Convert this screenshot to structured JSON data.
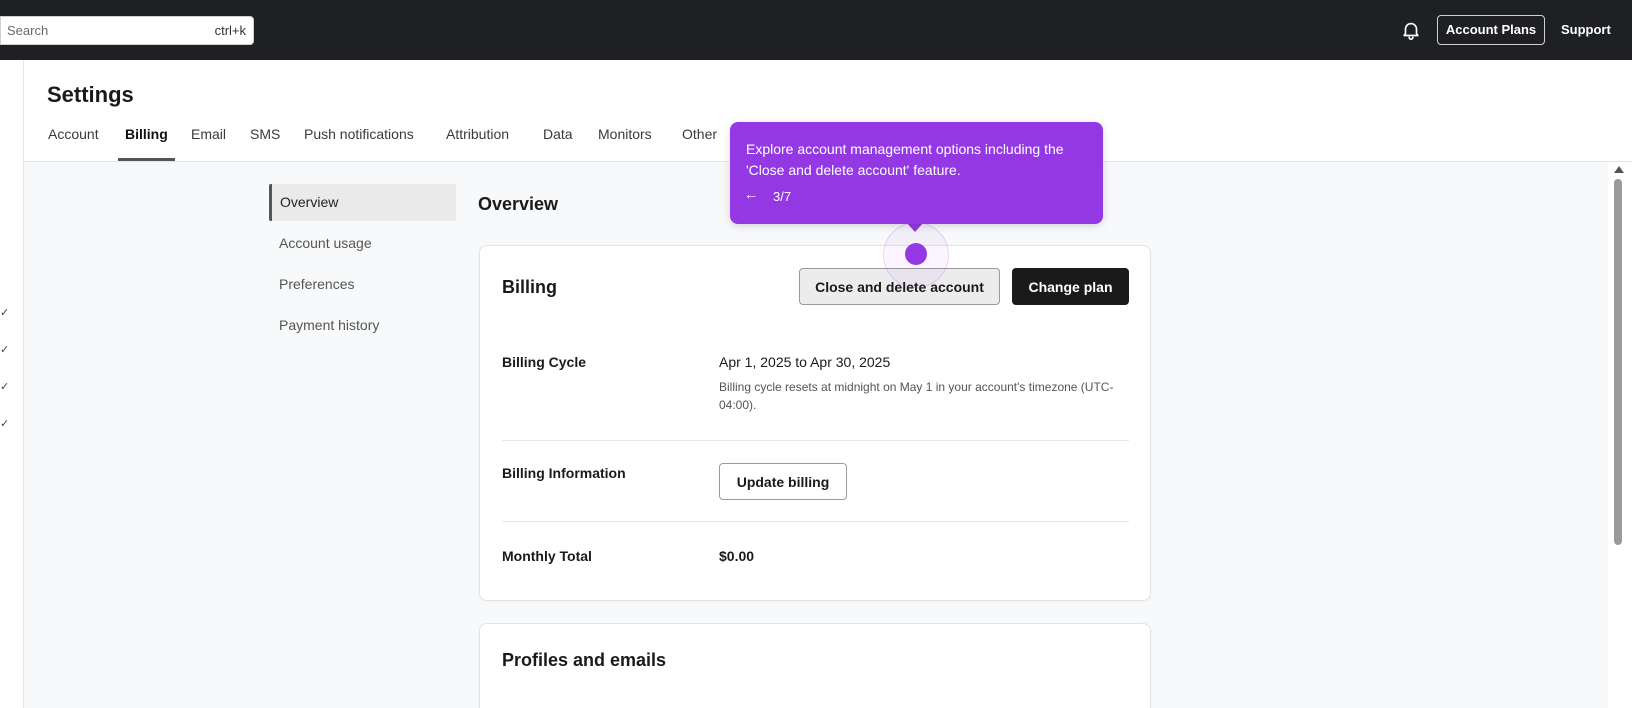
{
  "topbar": {
    "search_placeholder": "Search",
    "search_shortcut": "ctrl+k",
    "account_plans_label": "Account Plans",
    "support_label": "Support",
    "icons": {
      "notifications": "bell-icon"
    }
  },
  "page": {
    "title": "Settings",
    "tabs": [
      {
        "label": "Account"
      },
      {
        "label": "Billing",
        "active": true
      },
      {
        "label": "Email"
      },
      {
        "label": "SMS"
      },
      {
        "label": "Push notifications"
      },
      {
        "label": "Attribution"
      },
      {
        "label": "Data"
      },
      {
        "label": "Monitors"
      },
      {
        "label": "Other"
      }
    ]
  },
  "left_strip": {
    "checks": [
      "✓",
      "✓",
      "✓",
      "✓"
    ]
  },
  "sidenav": {
    "items": [
      {
        "label": "Overview",
        "active": true
      },
      {
        "label": "Account usage"
      },
      {
        "label": "Preferences"
      },
      {
        "label": "Payment history"
      }
    ]
  },
  "overview": {
    "title": "Overview",
    "billing_card": {
      "title": "Billing",
      "close_delete_label": "Close and delete account",
      "change_plan_label": "Change plan",
      "billing_cycle_label": "Billing Cycle",
      "billing_cycle_value": "Apr 1, 2025 to Apr 30, 2025",
      "billing_cycle_note": "Billing cycle resets at midnight on May 1 in your account's timezone (UTC-04:00).",
      "billing_info_label": "Billing Information",
      "update_billing_label": "Update billing",
      "monthly_total_label": "Monthly Total",
      "monthly_total_value": "$0.00"
    },
    "profiles_card": {
      "title": "Profiles and emails"
    }
  },
  "tooltip": {
    "text": "Explore account management options including the 'Close and delete account' feature.",
    "back_arrow": "←",
    "step": "3/7",
    "color": "#9438e4"
  }
}
